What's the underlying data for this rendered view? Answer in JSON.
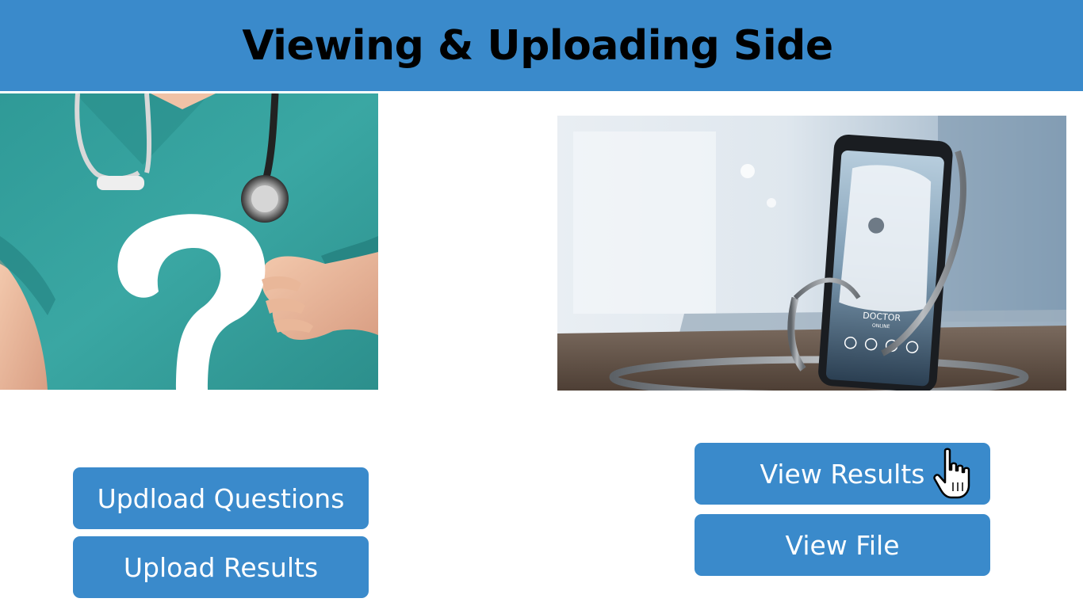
{
  "header": {
    "title": "Viewing & Uploading Side",
    "background_color": "#3a8acb"
  },
  "left_panel": {
    "image_icon": "nurse-question-mark-photo",
    "buttons": [
      {
        "label": "Updload Questions"
      },
      {
        "label": "Upload Results"
      }
    ]
  },
  "right_panel": {
    "image_icon": "phone-doctor-online-photo",
    "phone_screen": {
      "line1": "DOCTOR",
      "line2": "ONLINE"
    },
    "buttons": [
      {
        "label": "View Results"
      },
      {
        "label": "View File"
      }
    ]
  },
  "cursor": {
    "icon": "hand-pointer-icon"
  },
  "colors": {
    "accent": "#3a8acb",
    "button_text": "#ffffff",
    "title_text": "#000000"
  }
}
